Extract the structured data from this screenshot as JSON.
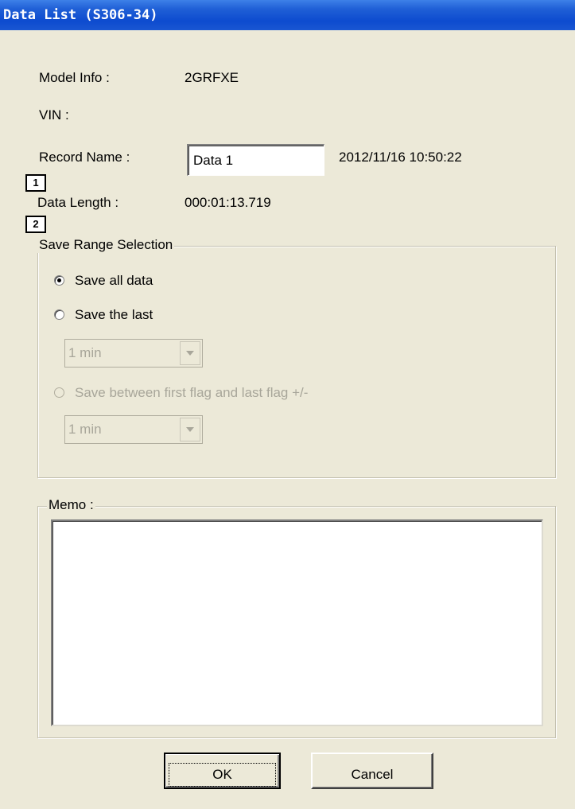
{
  "window": {
    "title": "Data List (S306-34)"
  },
  "fields": {
    "model_info_label": "Model Info :",
    "model_info_value": "2GRFXE",
    "vin_label": "VIN :",
    "vin_value": "",
    "record_name_label": "Record Name :",
    "record_name_value": "Data 1",
    "record_timestamp": "2012/11/16 10:50:22",
    "data_length_label": "Data Length :",
    "data_length_value": "000:01:13.719"
  },
  "markers": [
    "1",
    "2"
  ],
  "save_range": {
    "legend": "Save Range Selection",
    "options": [
      {
        "label": "Save all data",
        "selected": true,
        "enabled": true
      },
      {
        "label": "Save the last",
        "selected": false,
        "enabled": true
      },
      {
        "label": "Save between first flag and last flag +/-",
        "selected": false,
        "enabled": false
      }
    ],
    "last_duration": "1 min",
    "flag_duration": "1 min"
  },
  "memo": {
    "legend": "Memo :",
    "value": ""
  },
  "buttons": {
    "ok": "OK",
    "cancel": "Cancel"
  },
  "icons": {
    "radio": "radio-button-icon",
    "dropdown": "chevron-down-icon"
  }
}
